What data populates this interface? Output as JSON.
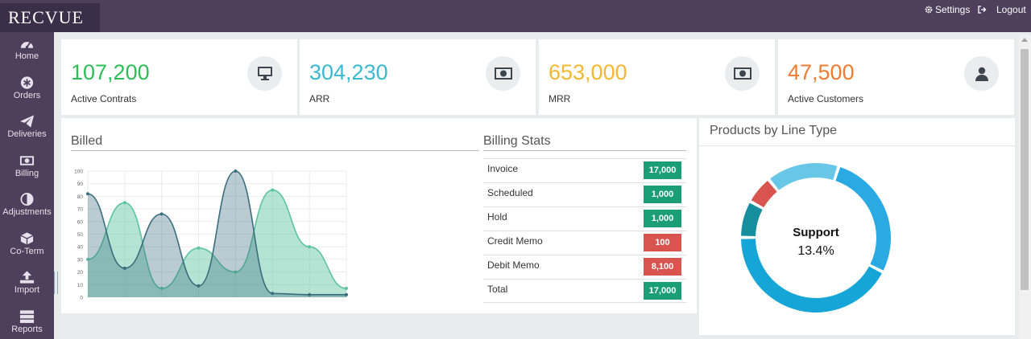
{
  "app": {
    "logo": "RECVUE"
  },
  "topbar": {
    "settings": "Settings",
    "logout": "Logout"
  },
  "sidebar": {
    "items": [
      {
        "label": "Home",
        "icon": "dashboard-icon"
      },
      {
        "label": "Orders",
        "icon": "asterisk-icon"
      },
      {
        "label": "Deliveries",
        "icon": "paper-plane-icon"
      },
      {
        "label": "Billing",
        "icon": "money-icon"
      },
      {
        "label": "Adjustments",
        "icon": "contrast-icon"
      },
      {
        "label": "Co-Term",
        "icon": "cube-icon"
      },
      {
        "label": "Import",
        "icon": "upload-icon"
      },
      {
        "label": "Reports",
        "icon": "server-icon"
      }
    ]
  },
  "kpis": [
    {
      "value": "107,200",
      "label": "Active Contrats",
      "color": "#2ebd59",
      "icon": "desktop-icon"
    },
    {
      "value": "304,230",
      "label": "ARR",
      "color": "#3bb9d1",
      "icon": "money-icon"
    },
    {
      "value": "653,000",
      "label": "MRR",
      "color": "#f5b731",
      "icon": "money-icon"
    },
    {
      "value": "47,500",
      "label": "Active Customers",
      "color": "#f07c32",
      "icon": "user-icon"
    }
  ],
  "billed": {
    "title": "Billed"
  },
  "billing_stats": {
    "title": "Billing Stats",
    "rows": [
      {
        "label": "Invoice",
        "value": "17,000",
        "color": "#1a9e74"
      },
      {
        "label": "Scheduled",
        "value": "1,000",
        "color": "#1a9e74"
      },
      {
        "label": "Hold",
        "value": "1,000",
        "color": "#1a9e74"
      },
      {
        "label": "Credit Memo",
        "value": "100",
        "color": "#d9534f"
      },
      {
        "label": "Debit Memo",
        "value": "8,100",
        "color": "#d9534f"
      },
      {
        "label": "Total",
        "value": "17,000",
        "color": "#1a9e74"
      }
    ]
  },
  "products": {
    "title": "Products by Line Type",
    "center_label": "Support",
    "center_value": "13.4%"
  },
  "chart_data": [
    {
      "type": "area",
      "title": "Billed",
      "x": [
        0,
        1,
        2,
        3,
        4,
        5,
        6,
        7
      ],
      "ylim": [
        0,
        100
      ],
      "yticks": [
        0,
        10,
        20,
        30,
        40,
        50,
        60,
        70,
        80,
        90,
        100
      ],
      "grid": true,
      "series": [
        {
          "values": [
            30,
            75,
            7,
            39,
            20,
            85,
            40,
            7
          ],
          "color": "#5cc4a0"
        },
        {
          "values": [
            82,
            23,
            66,
            9,
            100,
            3,
            2,
            2
          ],
          "color": "#3a6e7c"
        }
      ]
    },
    {
      "type": "pie",
      "title": "Products by Line Type",
      "labels": [
        "Support",
        "",
        "",
        "",
        ""
      ],
      "values": [
        13.4,
        23.5,
        36.2,
        6.8,
        5.2
      ],
      "colors": [
        "#68c6e6",
        "#2aa9e3",
        "#15a5d6",
        "#178e9d",
        "#fcc21c",
        "#d9534f"
      ]
    }
  ]
}
